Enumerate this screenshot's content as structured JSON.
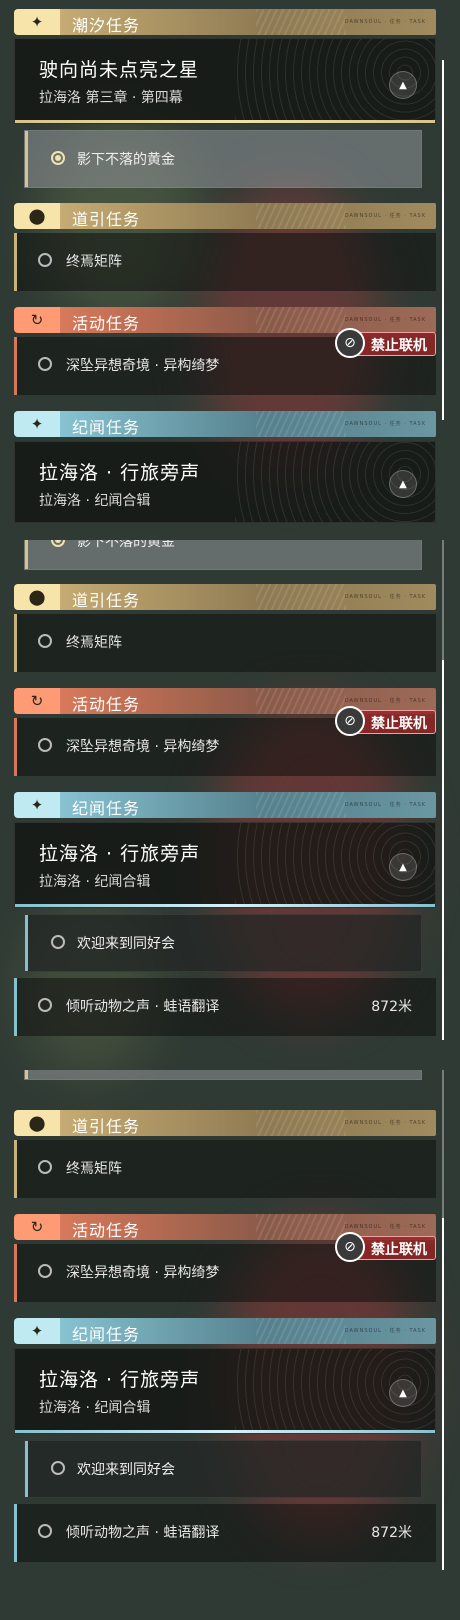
{
  "sections": {
    "tide": {
      "title": "潮汐任务"
    },
    "guide": {
      "title": "道引任务"
    },
    "event": {
      "title": "活动任务"
    },
    "chronicle": {
      "title": "纪闻任务"
    }
  },
  "tide_card": {
    "title": "驶向尚未点亮之星",
    "subtitle": "拉海洛 第三章 · 第四幕"
  },
  "chronicle_card": {
    "title": "拉海洛 · 行旅旁声",
    "subtitle": "拉海洛 · 纪闻合辑"
  },
  "tide_objective": "影下不落的黄金",
  "guide_item": "终焉矩阵",
  "event_item": "深坠异想奇境 · 异构绮梦",
  "no_coop_badge": "禁止联机",
  "chronicle_sub_item": "欢迎来到同好会",
  "chronicle_item": {
    "label": "倾听动物之声 · 蛙语翻译",
    "distance": "872米"
  },
  "header_deco": "DAWNSOUL · 任务 · TASK",
  "colors": {
    "gold": "#e7d49a",
    "orange": "#f08a64",
    "blue": "#aedfea",
    "badge": "#962828"
  }
}
